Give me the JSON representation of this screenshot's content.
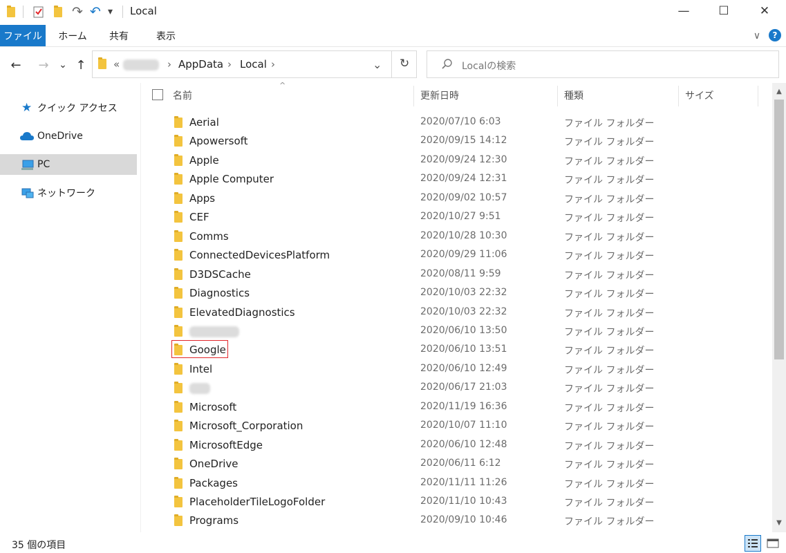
{
  "window": {
    "title": "Local",
    "minimize": "—",
    "maximize": "☐",
    "close": "✕"
  },
  "quick_access_toolbar": {
    "undo_glyph": "↶",
    "redo_glyph": "↷",
    "dropdown_glyph": "▾"
  },
  "ribbon": {
    "tabs": [
      {
        "label": "ファイル",
        "active": true
      },
      {
        "label": "ホーム"
      },
      {
        "label": "共有"
      },
      {
        "label": "表示"
      }
    ],
    "expand_glyph": "∨",
    "help_glyph": "?"
  },
  "navigation": {
    "back": "←",
    "forward": "→",
    "recent": "⌄",
    "up": "↑"
  },
  "address_bar": {
    "overflow": "«",
    "segments": [
      "AppData",
      "Local"
    ],
    "separator": "›",
    "dropdown": "⌄",
    "refresh": "↻"
  },
  "search": {
    "placeholder": "Localの検索"
  },
  "sidebar": {
    "items": [
      {
        "label": "クイック アクセス",
        "icon": "star-icon"
      },
      {
        "label": "OneDrive",
        "icon": "cloud-icon"
      },
      {
        "label": "PC",
        "icon": "computer-icon",
        "selected": true
      },
      {
        "label": "ネットワーク",
        "icon": "network-icon"
      }
    ]
  },
  "columns": {
    "name": "名前",
    "date": "更新日時",
    "type": "種類",
    "size": "サイズ",
    "sort_glyph": "^"
  },
  "files": [
    {
      "name": "Aerial",
      "date": "2020/07/10 6:03",
      "type": "ファイル フォルダー"
    },
    {
      "name": "Apowersoft",
      "date": "2020/09/15 14:12",
      "type": "ファイル フォルダー"
    },
    {
      "name": "Apple",
      "date": "2020/09/24 12:30",
      "type": "ファイル フォルダー"
    },
    {
      "name": "Apple Computer",
      "date": "2020/09/24 12:31",
      "type": "ファイル フォルダー"
    },
    {
      "name": "Apps",
      "date": "2020/09/02 10:57",
      "type": "ファイル フォルダー"
    },
    {
      "name": "CEF",
      "date": "2020/10/27 9:51",
      "type": "ファイル フォルダー"
    },
    {
      "name": "Comms",
      "date": "2020/10/28 10:30",
      "type": "ファイル フォルダー"
    },
    {
      "name": "ConnectedDevicesPlatform",
      "date": "2020/09/29 11:06",
      "type": "ファイル フォルダー"
    },
    {
      "name": "D3DSCache",
      "date": "2020/08/11 9:59",
      "type": "ファイル フォルダー"
    },
    {
      "name": "Diagnostics",
      "date": "2020/10/03 22:32",
      "type": "ファイル フォルダー"
    },
    {
      "name": "ElevatedDiagnostics",
      "date": "2020/10/03 22:32",
      "type": "ファイル フォルダー"
    },
    {
      "name": "",
      "date": "2020/06/10 13:50",
      "type": "ファイル フォルダー",
      "redacted": true
    },
    {
      "name": "Google",
      "date": "2020/06/10 13:51",
      "type": "ファイル フォルダー",
      "highlighted": true
    },
    {
      "name": "Intel",
      "date": "2020/06/10 12:49",
      "type": "ファイル フォルダー"
    },
    {
      "name": "",
      "date": "2020/06/17 21:03",
      "type": "ファイル フォルダー",
      "redacted": true
    },
    {
      "name": "Microsoft",
      "date": "2020/11/19 16:36",
      "type": "ファイル フォルダー"
    },
    {
      "name": "Microsoft_Corporation",
      "date": "2020/10/07 11:10",
      "type": "ファイル フォルダー"
    },
    {
      "name": "MicrosoftEdge",
      "date": "2020/06/10 12:48",
      "type": "ファイル フォルダー"
    },
    {
      "name": "OneDrive",
      "date": "2020/06/11 6:12",
      "type": "ファイル フォルダー"
    },
    {
      "name": "Packages",
      "date": "2020/11/11 11:26",
      "type": "ファイル フォルダー"
    },
    {
      "name": "PlaceholderTileLogoFolder",
      "date": "2020/11/10 10:43",
      "type": "ファイル フォルダー"
    },
    {
      "name": "Programs",
      "date": "2020/09/10 10:46",
      "type": "ファイル フォルダー"
    }
  ],
  "status": {
    "item_count": "35 個の項目"
  },
  "colors": {
    "accent": "#1979ca",
    "folder": "#f3c43f",
    "highlight": "#e2262a",
    "selected": "#d9d9d9"
  }
}
